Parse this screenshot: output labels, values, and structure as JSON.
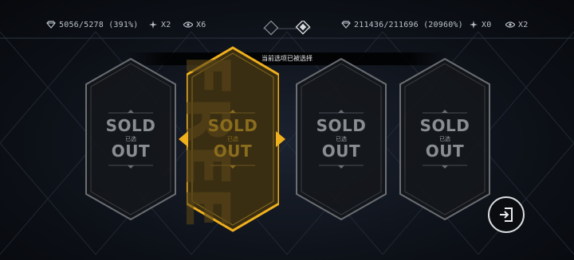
{
  "hud": {
    "left": {
      "shards": "5056/5278 (391%)",
      "tokens": "X2",
      "eyes": "X6"
    },
    "right": {
      "shards": "211436/211696 (20960%)",
      "tokens": "X0",
      "eyes": "X2"
    }
  },
  "banner": "当前选项已被选择",
  "cards": [
    {
      "top": "SOLD",
      "mid": "已选",
      "bottom": "OUT",
      "selected": false
    },
    {
      "top": "SOLD",
      "mid": "已选",
      "bottom": "OUT",
      "selected": true
    },
    {
      "top": "SOLD",
      "mid": "已选",
      "bottom": "OUT",
      "selected": false
    },
    {
      "top": "SOLD",
      "mid": "已选",
      "bottom": "OUT",
      "selected": false
    }
  ],
  "colors": {
    "accent": "#f0b01e",
    "frame": "#6b6f74"
  },
  "exit_icon": "exit-icon"
}
